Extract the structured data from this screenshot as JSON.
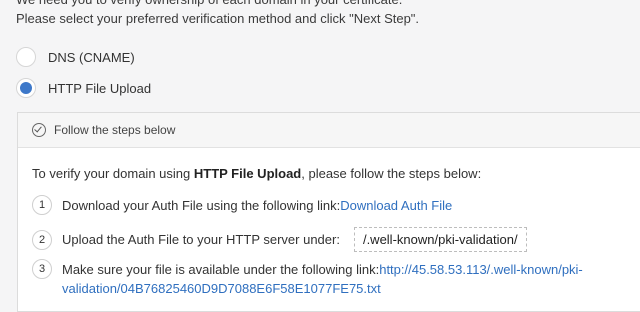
{
  "intro": {
    "line1": "We need you to verify ownership of each domain in your certificate.",
    "line2": "Please select your preferred verification method and click \"Next Step\"."
  },
  "options": [
    {
      "label": "DNS (CNAME)",
      "checked": false
    },
    {
      "label": "HTTP File Upload",
      "checked": true
    }
  ],
  "panel": {
    "header": "Follow the steps below",
    "instruction_pre": "To verify your domain using ",
    "instruction_bold": "HTTP File Upload",
    "instruction_post": ", please follow the steps below:",
    "steps": [
      {
        "num": "1",
        "text": "Download your Auth File using the following link: ",
        "link": "Download Auth File"
      },
      {
        "num": "2",
        "text": "Upload the Auth File to your HTTP server under:",
        "code": "/.well-known/pki-validation/"
      },
      {
        "num": "3",
        "text": "Make sure your file is available under the following link: ",
        "link_part1": "http://45.58.53.113/.well-known/pki-",
        "link_part2": "validation/04B76825460D9D7088E6F58E1077FE75.txt"
      }
    ]
  },
  "colors": {
    "accent": "#3d78c9",
    "link": "#2f6fbf"
  },
  "icons": {
    "panel_header": "check-circle-icon"
  }
}
